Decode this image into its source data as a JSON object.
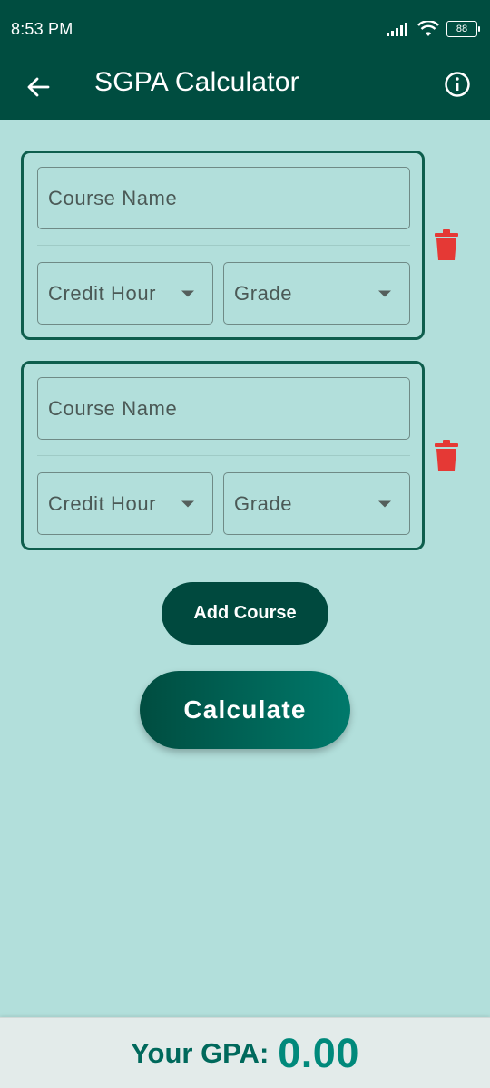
{
  "status_bar": {
    "time": "8:53 PM",
    "battery": "88"
  },
  "app_bar": {
    "title": "SGPA Calculator",
    "back_icon": "arrow-left-icon",
    "info_icon": "info-icon"
  },
  "courses": [
    {
      "name_placeholder": "Course Name",
      "credit_placeholder": "Credit Hour",
      "grade_placeholder": "Grade"
    },
    {
      "name_placeholder": "Course Name",
      "credit_placeholder": "Credit Hour",
      "grade_placeholder": "Grade"
    }
  ],
  "actions": {
    "add_course": "Add Course",
    "calculate": "Calculate"
  },
  "result": {
    "label": "Your GPA:",
    "value": "0.00"
  },
  "colors": {
    "primary": "#004d40",
    "background": "#b2dfdb",
    "delete": "#e53935",
    "accent": "#00897b"
  }
}
